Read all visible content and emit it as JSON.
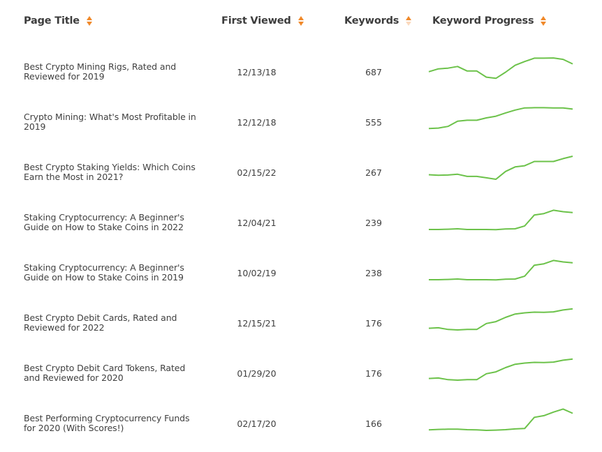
{
  "table": {
    "columns": [
      {
        "label": "Page Title",
        "sort_icon": "sort-both-icon",
        "sort_state": "none"
      },
      {
        "label": "First Viewed",
        "sort_icon": "sort-both-icon",
        "sort_state": "none"
      },
      {
        "label": "Keywords",
        "sort_icon": "sort-ascending-icon",
        "sort_state": "ascending-highlighted"
      },
      {
        "label": "Keyword Progress",
        "sort_icon": "sort-both-icon",
        "sort_state": "none"
      }
    ],
    "accent_color": "#f0892a",
    "sparkline_color": "#6cc24a",
    "rows": [
      {
        "title": "Best Crypto Mining Rigs, Rated and Reviewed for 2019",
        "first_viewed": "12/13/18",
        "keywords": "687",
        "progress": [
          33,
          45,
          48,
          55,
          36,
          36,
          10,
          5,
          31,
          60,
          76,
          90,
          90,
          91,
          85,
          66
        ]
      },
      {
        "title": "Crypto Mining: What's Most Profitable in 2019",
        "first_viewed": "12/12/18",
        "keywords": "555",
        "progress": [
          5,
          7,
          14,
          36,
          40,
          40,
          50,
          57,
          71,
          83,
          92,
          93,
          93,
          92,
          92,
          87
        ]
      },
      {
        "title": "Best Crypto Staking Yields: Which Coins Earn the Most in 2021?",
        "first_viewed": "02/15/22",
        "keywords": "267",
        "progress": [
          22,
          20,
          21,
          24,
          15,
          15,
          9,
          3,
          36,
          55,
          60,
          78,
          78,
          78,
          90,
          100
        ]
      },
      {
        "title": "Staking Cryptocurrency: A Beginner's Guide on How to Stake Coins in 2022",
        "first_viewed": "12/04/21",
        "keywords": "239",
        "progress": [
          3,
          3,
          4,
          6,
          3,
          3,
          3,
          2,
          5,
          6,
          18,
          64,
          70,
          84,
          78,
          74
        ]
      },
      {
        "title": "Staking Cryptocurrency: A Beginner's Guide on How to Stake Coins in 2019",
        "first_viewed": "10/02/19",
        "keywords": "238",
        "progress": [
          3,
          3,
          4,
          6,
          3,
          3,
          3,
          2,
          5,
          6,
          18,
          64,
          70,
          84,
          78,
          74
        ]
      },
      {
        "title": "Best Crypto Debit Cards, Rated and Reviewed for 2022",
        "first_viewed": "12/15/21",
        "keywords": "176",
        "progress": [
          10,
          12,
          5,
          3,
          5,
          5,
          30,
          38,
          56,
          70,
          75,
          78,
          77,
          79,
          87,
          92
        ]
      },
      {
        "title": "Best Crypto Debit Card Tokens, Rated and Reviewed for 2020",
        "first_viewed": "01/29/20",
        "keywords": "176",
        "progress": [
          10,
          12,
          5,
          3,
          5,
          5,
          30,
          38,
          56,
          70,
          75,
          78,
          77,
          79,
          87,
          92
        ]
      },
      {
        "title": "Best Performing Cryptocurrency Funds for 2020 (With Scores!)",
        "first_viewed": "02/17/20",
        "keywords": "166",
        "progress": [
          5,
          7,
          8,
          8,
          6,
          5,
          3,
          4,
          6,
          9,
          11,
          58,
          65,
          80,
          93,
          75
        ]
      }
    ]
  }
}
